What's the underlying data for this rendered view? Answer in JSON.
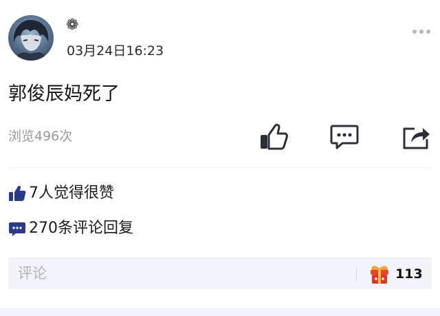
{
  "post": {
    "username": "❁",
    "timestamp": "03月24日16:23",
    "text": "郭俊辰妈死了",
    "views": "浏览496次"
  },
  "stats": {
    "likes": "7人觉得很赞",
    "comments": "270条评论回复"
  },
  "comment_bar": {
    "placeholder": "评论",
    "gift_count": "113"
  },
  "icons": {
    "more": "more-dots-icon",
    "like": "thumbs-up-icon",
    "comment": "comment-bubble-icon",
    "share": "share-arrow-icon",
    "like_stat": "thumbs-up-small-icon",
    "comment_stat": "comment-bubble-small-icon",
    "gift": "gift-icon"
  },
  "colors": {
    "accent": "#2d3a8c",
    "icon": "#222222",
    "muted": "#9a9a9a",
    "gift": "#e8462f"
  }
}
